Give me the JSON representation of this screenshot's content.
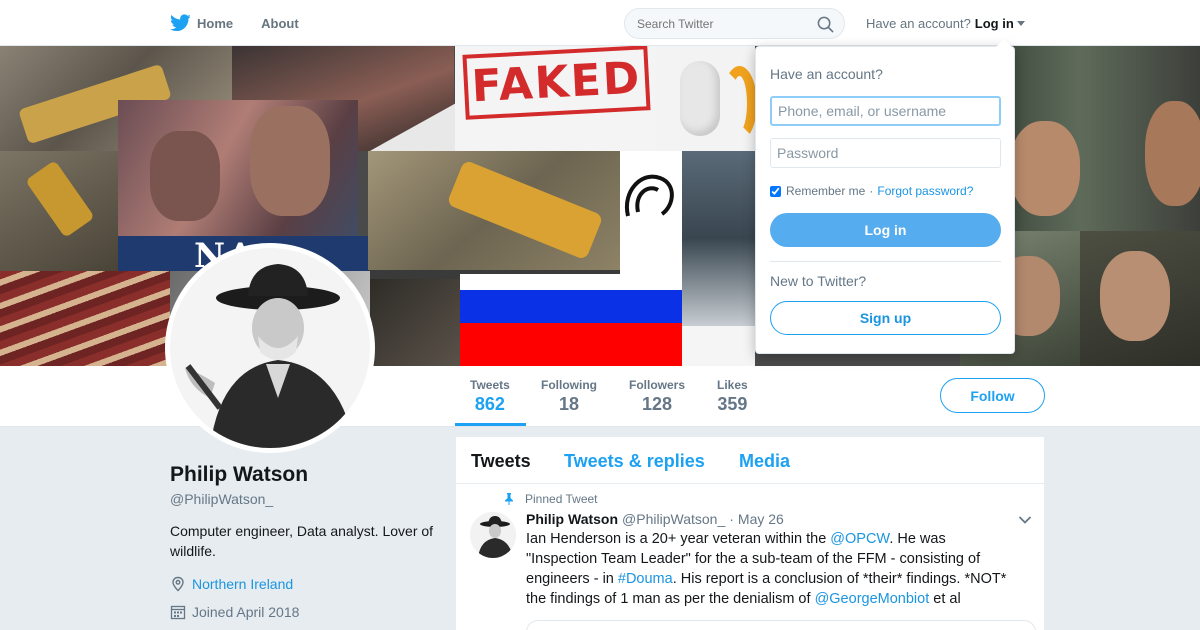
{
  "nav": {
    "home_label": "Home",
    "about_label": "About",
    "search_placeholder": "Search Twitter",
    "have_account": "Have an account?",
    "login_label": "Log in"
  },
  "banner": {
    "stamp_text": "FAKED",
    "overlay_text": "NA"
  },
  "profile": {
    "name": "Philip Watson",
    "handle": "@PhilipWatson_",
    "bio": "Computer engineer, Data analyst. Lover of wildlife.",
    "location": "Northern Ireland",
    "joined": "Joined April 2018"
  },
  "stats": [
    {
      "label": "Tweets",
      "value": "862"
    },
    {
      "label": "Following",
      "value": "18"
    },
    {
      "label": "Followers",
      "value": "128"
    },
    {
      "label": "Likes",
      "value": "359"
    }
  ],
  "follow_label": "Follow",
  "timeline": {
    "tabs": [
      "Tweets",
      "Tweets & replies",
      "Media"
    ],
    "pinned_label": "Pinned Tweet",
    "tweet": {
      "author": "Philip Watson",
      "handle": "@PhilipWatson_",
      "separator": "·",
      "date": "May 26",
      "text_1": "Ian Henderson is a 20+ year veteran within the ",
      "mention_1": "@OPCW",
      "text_2": ".  He was \"Inspection Team Leader\" for the a sub-team of the FFM  - consisting of engineers - in ",
      "hashtag": "#Douma",
      "text_3": ". His report is a conclusion of *their* findings. *NOT* the findings of 1 man as per the denialism of ",
      "mention_2": "@GeorgeMonbiot",
      "text_4": " et al"
    }
  },
  "login_dropdown": {
    "title": "Have an account?",
    "username_placeholder": "Phone, email, or username",
    "password_placeholder": "Password",
    "remember_label": "Remember me",
    "separator": "·",
    "forgot_label": "Forgot password?",
    "login_button": "Log in",
    "new_label": "New to Twitter?",
    "signup_button": "Sign up"
  },
  "colors": {
    "accent": "#1da1f2",
    "link": "#1b95e0",
    "login_button": "#55acee",
    "page_bg": "#e6ecf0"
  }
}
